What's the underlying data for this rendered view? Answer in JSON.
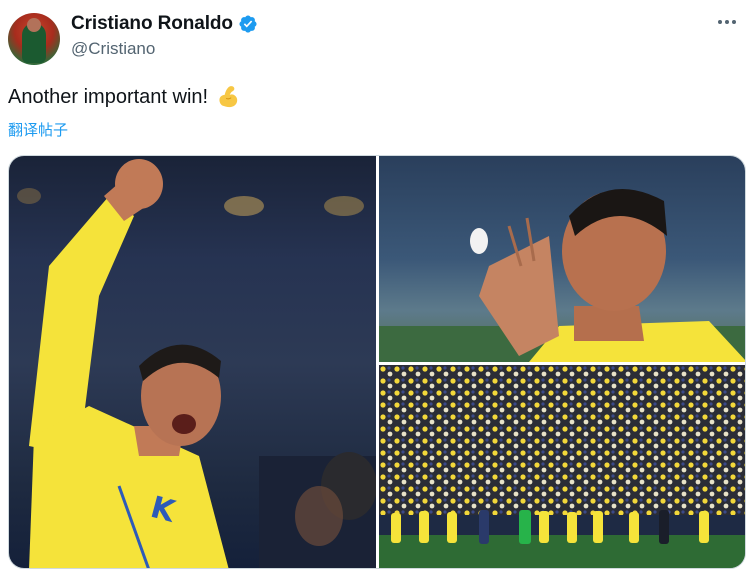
{
  "author": {
    "display_name": "Cristiano Ronaldo",
    "handle": "@Cristiano",
    "verified": true,
    "verified_color": "#1d9bf0"
  },
  "tweet": {
    "text": "Another important win!",
    "emoji": "flexed-biceps",
    "translate_label": "翻译帖子"
  },
  "media": {
    "photos": [
      {
        "name": "celebration-fist-photo"
      },
      {
        "name": "applause-photo"
      },
      {
        "name": "fans-stadium-photo"
      }
    ],
    "kit_color": "#f5e33a"
  }
}
